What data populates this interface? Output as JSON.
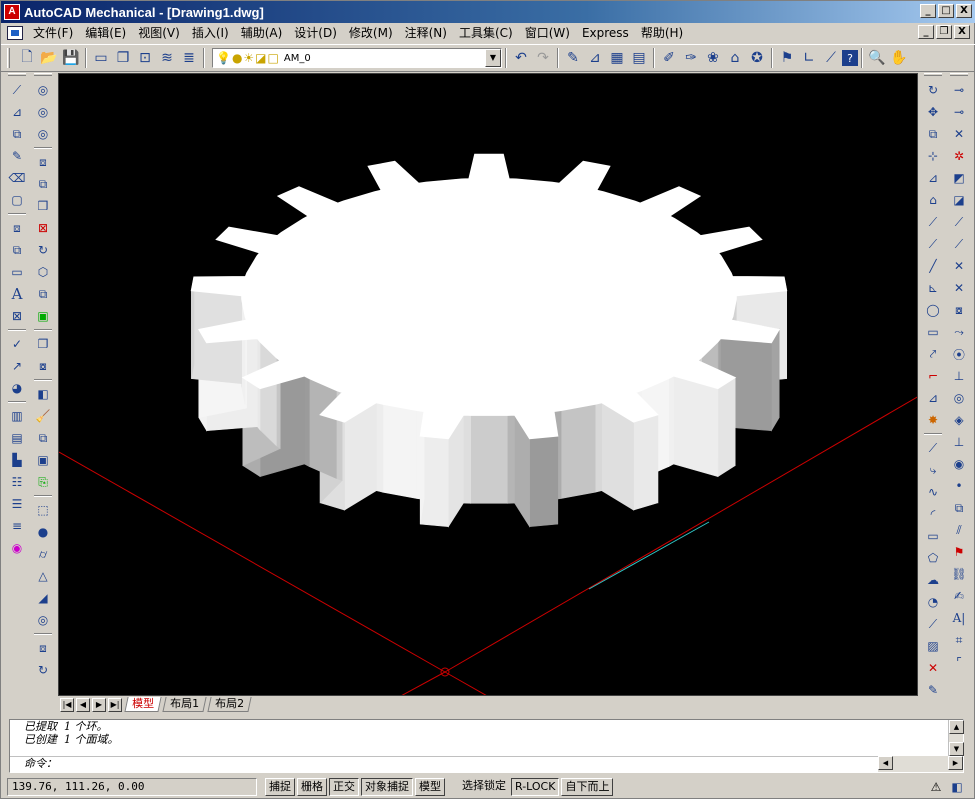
{
  "window": {
    "title": "AutoCAD Mechanical - [Drawing1.dwg]",
    "controls": [
      "_",
      "□",
      "X"
    ]
  },
  "menubar": {
    "items": [
      "文件(F)",
      "编辑(E)",
      "视图(V)",
      "插入(I)",
      "辅助(A)",
      "设计(D)",
      "修改(M)",
      "注释(N)",
      "工具集(C)",
      "窗口(W)",
      "Express",
      "帮助(H)"
    ],
    "mdi_controls": [
      "_",
      "❐",
      "X"
    ]
  },
  "toolbar": {
    "layer_name": "AM_0"
  },
  "tabs": {
    "items": [
      "模型",
      "布局1",
      "布局2"
    ],
    "active": "模型",
    "nav": [
      "|◀",
      "◀",
      "▶",
      "▶|"
    ]
  },
  "command": {
    "history": [
      "已提取  1 个环。",
      "已创建  1 个面域。"
    ],
    "prompt": "命令："
  },
  "status": {
    "coordinates": "139.76, 111.26, 0.00",
    "toggles": [
      "捕捉",
      "栅格",
      "正交",
      "对象捕捉",
      "模型"
    ],
    "extras": [
      "选择锁定",
      "R-LOCK",
      "自下而上"
    ]
  },
  "colors": {
    "viewport_bg": "#000000",
    "gear_top": "#ffffff",
    "gear_side": "#c9c9c9",
    "ucs_red": "#cc0000",
    "ucs_cyan": "#2ec4c4"
  }
}
